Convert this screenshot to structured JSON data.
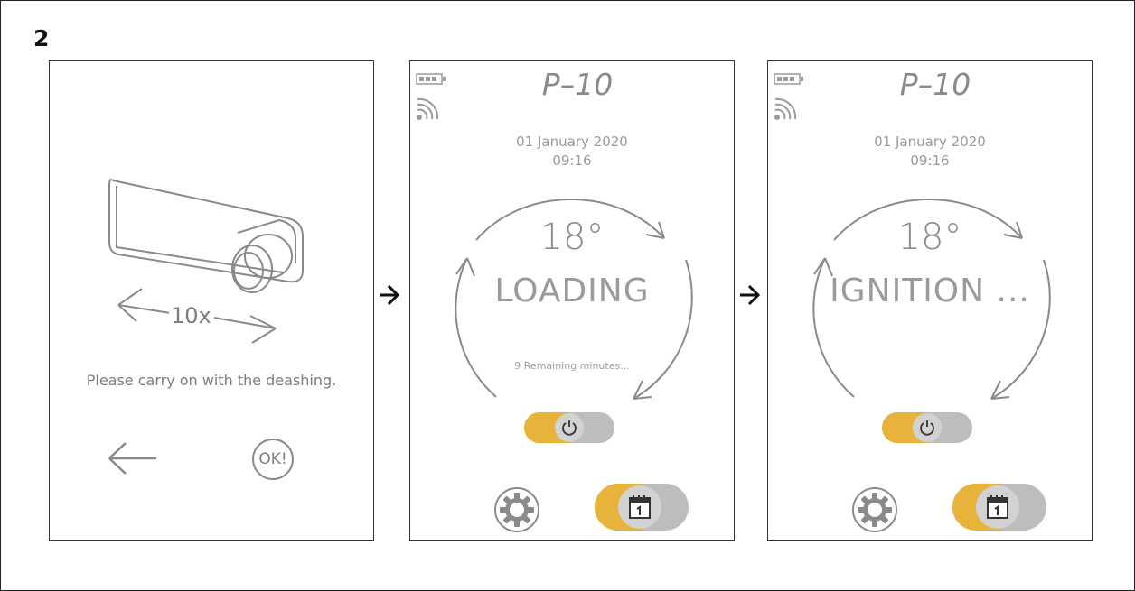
{
  "step_number": "2",
  "screen1": {
    "count_label": "10x",
    "instruction": "Please carry on with the deashing.",
    "back_icon": "left-arrow-icon",
    "ok_label": "OK!"
  },
  "screen2": {
    "model": "P–10",
    "date": "01 January 2020",
    "time": "09:16",
    "temperature": "18°",
    "status": "LOADING",
    "remaining": "9 Remaining minutes..."
  },
  "screen3": {
    "model": "P–10",
    "date": "01 January 2020",
    "time": "09:16",
    "temperature": "18°",
    "status": "IGNITION ..."
  },
  "icons": [
    "battery-icon",
    "wifi-icon",
    "power-icon",
    "gear-icon",
    "calendar-icon",
    "right-arrow-icon"
  ],
  "colors": {
    "accent": "#e8b33a",
    "track": "#bdbdbd",
    "line": "#8a8a8a"
  }
}
